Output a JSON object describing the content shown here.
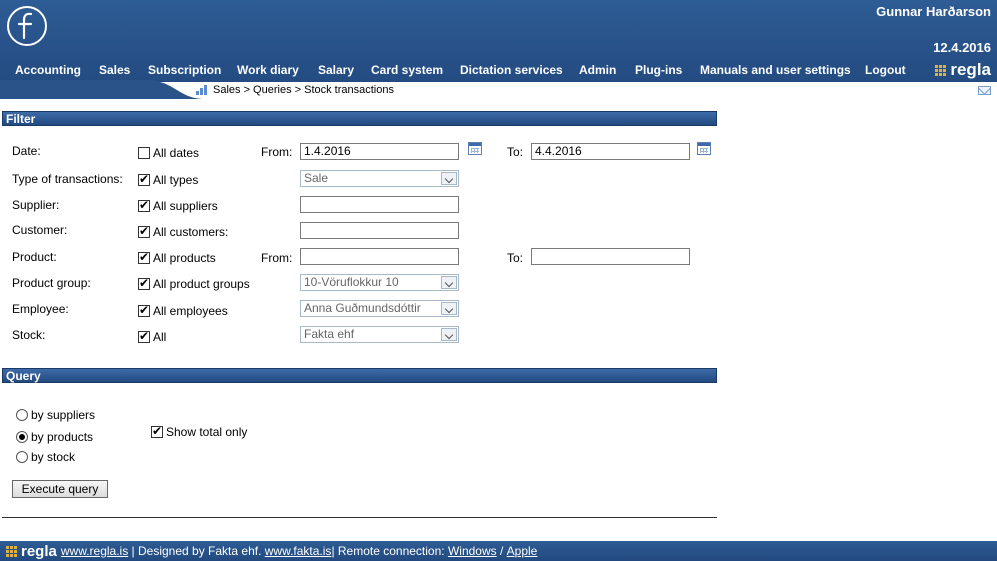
{
  "header": {
    "user": "Gunnar Harðarson",
    "date": "12.4.2016",
    "brand": "regla",
    "nav": [
      "Accounting",
      "Sales",
      "Subscription",
      "Work diary",
      "Salary",
      "Card system",
      "Dictation services",
      "Admin",
      "Plug-ins",
      "Manuals and user settings",
      "Logout"
    ]
  },
  "breadcrumb": "Sales > Queries > Stock transactions",
  "filter": {
    "title": "Filter",
    "date_label": "Date:",
    "all_dates": "All dates",
    "from_label": "From:",
    "from_value": "1.4.2016",
    "to_label": "To:",
    "to_value": "4.4.2016",
    "type_label": "Type of transactions:",
    "all_types": "All types",
    "type_value": "Sale",
    "supplier_label": "Supplier:",
    "all_suppliers": "All suppliers",
    "customer_label": "Customer:",
    "all_customers": "All customers:",
    "product_label": "Product:",
    "all_products": "All products",
    "product_from_label": "From:",
    "product_to_label": "To:",
    "group_label": "Product group:",
    "all_groups": "All product groups",
    "group_value": "10-Vöruflokkur 10",
    "employee_label": "Employee:",
    "all_employees": "All employees",
    "employee_value": "Anna Guðmundsdóttir",
    "stock_label": "Stock:",
    "all_stock": "All",
    "stock_value": "Fakta ehf"
  },
  "query": {
    "title": "Query",
    "by_suppliers": "by suppliers",
    "by_products": "by products",
    "by_stock": "by stock",
    "show_total": "Show total only",
    "execute": "Execute query"
  },
  "footer": {
    "brand": "regla",
    "site": "www.regla.is",
    "designed": " | Designed by Fakta ehf. ",
    "fakta": "www.fakta.is",
    "remote": "| Remote connection: ",
    "windows": "Windows",
    "sep": " / ",
    "apple": "Apple"
  }
}
